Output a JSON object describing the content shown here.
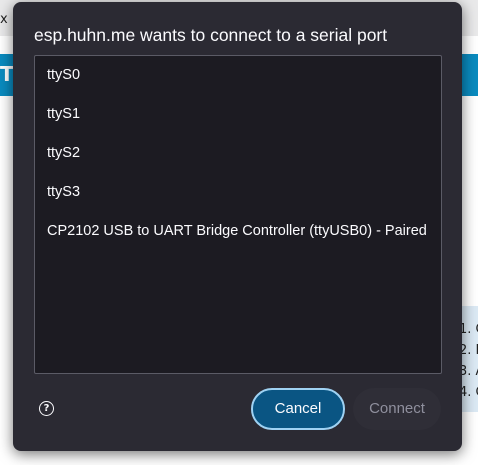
{
  "background": {
    "tab_fragment": "x",
    "header_fragment": "T",
    "list_fragments": [
      "1. C",
      "2. P",
      "3. A",
      "4. C"
    ]
  },
  "dialog": {
    "title": "esp.huhn.me wants to connect to a serial port",
    "ports": [
      {
        "label": "ttyS0"
      },
      {
        "label": "ttyS1"
      },
      {
        "label": "ttyS2"
      },
      {
        "label": "ttyS3"
      },
      {
        "label": "CP2102 USB to UART Bridge Controller (ttyUSB0) - Paired"
      }
    ],
    "help_icon_glyph": "?",
    "cancel_label": "Cancel",
    "connect_label": "Connect"
  },
  "colors": {
    "dialog_bg": "#2b2a33",
    "list_bg": "#1c1b22",
    "accent_button": "#0a5583",
    "accent_border": "#9fd2f3",
    "disabled_text": "#8f8f9d",
    "page_header": "#0a8bbf"
  }
}
